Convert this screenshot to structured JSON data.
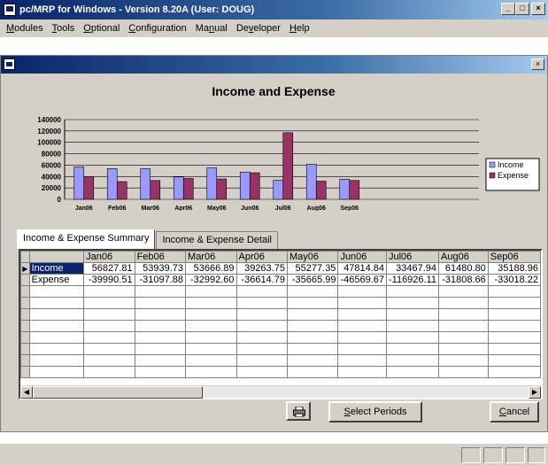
{
  "window": {
    "title": "pc/MRP for Windows - Version 8.20A  (User: DOUG)",
    "min_label": "_",
    "max_label": "□",
    "close_label": "×"
  },
  "menu": [
    {
      "pre": "",
      "u": "M",
      "post": "odules"
    },
    {
      "pre": "",
      "u": "T",
      "post": "ools"
    },
    {
      "pre": "",
      "u": "O",
      "post": "ptional"
    },
    {
      "pre": "",
      "u": "C",
      "post": "onfiguration"
    },
    {
      "pre": "Ma",
      "u": "n",
      "post": "ual"
    },
    {
      "pre": "De",
      "u": "v",
      "post": "eloper"
    },
    {
      "pre": "",
      "u": "H",
      "post": "elp"
    }
  ],
  "child_window": {
    "close_label": "×"
  },
  "chart_data": {
    "type": "bar",
    "title": "Income and Expense",
    "categories": [
      "Jan06",
      "Feb06",
      "Mar06",
      "Apr06",
      "May06",
      "Jun06",
      "Jul06",
      "Aug06",
      "Sep06"
    ],
    "series": [
      {
        "name": "Income",
        "values": [
          56827.81,
          53939.73,
          53666.89,
          39263.75,
          55277.35,
          47814.84,
          33467.94,
          61480.8,
          35188.96
        ],
        "color": "#9999ff"
      },
      {
        "name": "Expense",
        "values": [
          39990.51,
          31097.88,
          32992.6,
          36614.79,
          35665.99,
          46569.67,
          116926.11,
          31808.66,
          33018.22
        ],
        "color": "#993366"
      }
    ],
    "y_ticks": [
      "0",
      "20000",
      "40000",
      "60000",
      "80000",
      "100000",
      "120000",
      "140000"
    ],
    "ylim": [
      0,
      140000
    ],
    "grid": true,
    "legend_position": "right"
  },
  "tabs": [
    {
      "label": "Income & Expense Summary",
      "active": true
    },
    {
      "label": "Income & Expense Detail",
      "active": false
    }
  ],
  "grid": {
    "columns": [
      "",
      "Jan06",
      "Feb06",
      "Mar06",
      "Apr06",
      "May06",
      "Jun06",
      "Jul06",
      "Aug06",
      "Sep06"
    ],
    "rows": [
      {
        "label": "Income",
        "values": [
          "56827.81",
          "53939.73",
          "53666.89",
          "39263.75",
          "55277.35",
          "47814.84",
          "33467.94",
          "61480.80",
          "35188.96"
        ],
        "selected": true
      },
      {
        "label": "Expense",
        "values": [
          "-39990.51",
          "-31097.88",
          "-32992.60",
          "-36614.79",
          "-35665.99",
          "-46569.67",
          "-116926.11",
          "-31808.66",
          "-33018.22"
        ],
        "selected": false
      }
    ],
    "empty_rows": 8
  },
  "buttons": {
    "print_icon": "printer-icon",
    "select_periods": {
      "u": "S",
      "post": "elect Periods"
    },
    "cancel": {
      "u": "C",
      "post": "ancel"
    }
  }
}
